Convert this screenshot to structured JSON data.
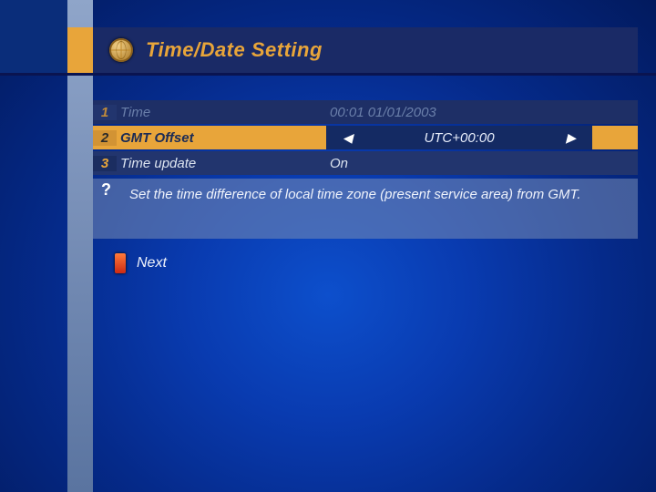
{
  "title": "Time/Date Setting",
  "rows": [
    {
      "num": "1",
      "label": "Time",
      "value": "00:01 01/01/2003"
    },
    {
      "num": "2",
      "label": "GMT Offset",
      "value": "UTC+00:00"
    },
    {
      "num": "3",
      "label": "Time update",
      "value": "On"
    }
  ],
  "help_text": "Set the time difference of local time zone (present service area) from GMT.",
  "next_label": "Next"
}
